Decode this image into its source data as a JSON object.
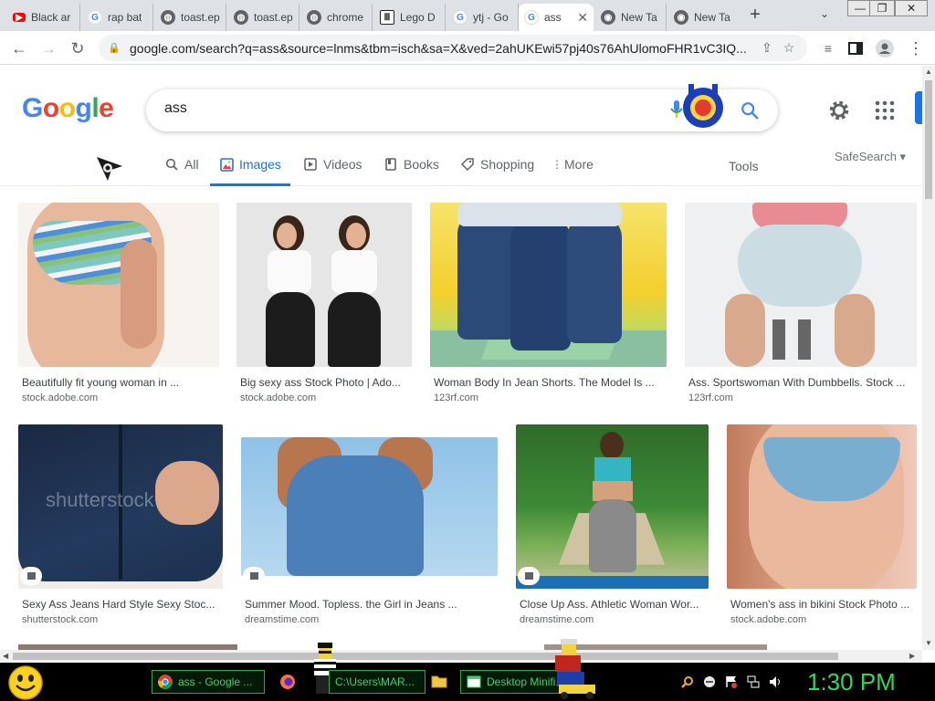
{
  "browser": {
    "tabs": [
      {
        "label": "Black ar",
        "favicon": "youtube-icon",
        "color": "#ff0000"
      },
      {
        "label": "rap bat",
        "favicon": "google-g-icon",
        "color": "#4285f4"
      },
      {
        "label": "toast.ep",
        "favicon": "globe-icon",
        "color": "#5f6368"
      },
      {
        "label": "toast.ep",
        "favicon": "globe-icon",
        "color": "#5f6368"
      },
      {
        "label": "chrome",
        "favicon": "globe-icon",
        "color": "#5f6368"
      },
      {
        "label": "Lego D",
        "favicon": "library-icon",
        "color": "#202124"
      },
      {
        "label": "ytj - Go",
        "favicon": "google-g-icon",
        "color": "#4285f4"
      },
      {
        "label": "ass",
        "favicon": "google-g-icon",
        "color": "#4285f4",
        "active": true
      },
      {
        "label": "New Ta",
        "favicon": "chrome-icon",
        "color": "#5f6368"
      },
      {
        "label": "New Ta",
        "favicon": "chrome-icon",
        "color": "#5f6368"
      }
    ],
    "new_tab": "+",
    "url": "google.com/search?q=ass&source=lnms&tbm=isch&sa=X&ved=2ahUKEwi57pj40s76AhUlomoFHR1vC3IQ...",
    "window_controls": [
      "—",
      "❐",
      "✕"
    ]
  },
  "google": {
    "logo": [
      "G",
      "o",
      "o",
      "g",
      "l",
      "e"
    ],
    "logo_colors": [
      "#4285f4",
      "#ea4335",
      "#fbbc05",
      "#4285f4",
      "#34a853",
      "#ea4335"
    ],
    "query": "ass",
    "nav": [
      {
        "label": "All",
        "icon": "search-icon"
      },
      {
        "label": "Images",
        "icon": "image-icon",
        "active": true
      },
      {
        "label": "Videos",
        "icon": "play-icon"
      },
      {
        "label": "Books",
        "icon": "book-icon"
      },
      {
        "label": "Shopping",
        "icon": "tag-icon"
      },
      {
        "label": "More",
        "icon": "more-vert-icon"
      }
    ],
    "tools": "Tools",
    "safesearch": "SafeSearch ▾",
    "results_row1": [
      {
        "title": "Beautifully fit young woman in ...",
        "source": "stock.adobe.com"
      },
      {
        "title": "Big sexy ass Stock Photo | Ado...",
        "source": "stock.adobe.com"
      },
      {
        "title": "Woman Body In Jean Shorts. The Model Is ...",
        "source": "123rf.com"
      },
      {
        "title": "Ass. Sportswoman With Dumbbells. Stock ...",
        "source": "123rf.com"
      }
    ],
    "results_row2": [
      {
        "title": "Sexy Ass Jeans Hard Style Sexy Stoc...",
        "source": "shutterstock.com"
      },
      {
        "title": "Summer Mood. Topless. the Girl in Jeans ...",
        "source": "dreamstime.com"
      },
      {
        "title": "Close Up Ass. Athletic Woman Wor...",
        "source": "dreamstime.com"
      },
      {
        "title": "Women's ass in bikini Stock Photo ...",
        "source": "stock.adobe.com"
      }
    ]
  },
  "taskbar": {
    "buttons": [
      {
        "label": "ass - Google ...",
        "icon": "chrome-icon"
      },
      {
        "label": "C:\\Users\\MAR...",
        "icon": "folder-icon"
      },
      {
        "label": "Desktop Minifi...",
        "icon": "window-icon"
      }
    ],
    "clock": "1:30 PM"
  }
}
